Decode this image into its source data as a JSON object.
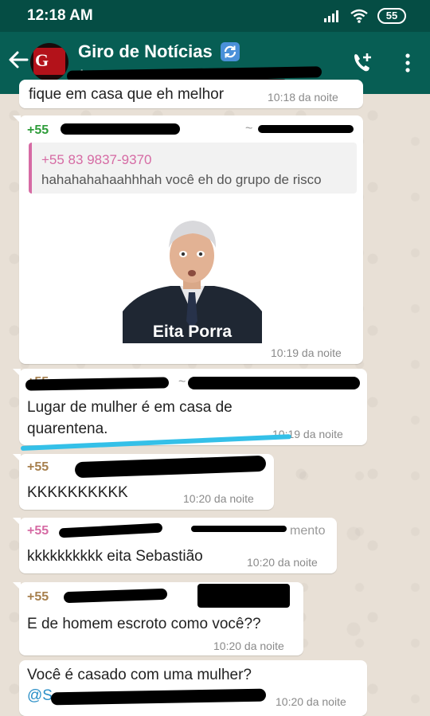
{
  "status_bar": {
    "time": "12:18 AM",
    "battery": "55"
  },
  "header": {
    "title": "Giro de Notícias",
    "subtitle": "A",
    "avatar_letter": "G"
  },
  "messages": [
    {
      "partial_text": "fique em casa que eh melhor",
      "time": "10:18 da noite"
    },
    {
      "sender": "+55",
      "sender_suffix": "~",
      "quote_sender": "+55 83 9837-9370",
      "quote_text": "hahahahahaahhhah você eh do grupo de risco",
      "sticker_caption": "Eita Porra",
      "time": "10:19 da noite"
    },
    {
      "sender": "+55",
      "sender_suffix": "~",
      "text_line1": "Lugar de mulher é em casa de",
      "text_line2": "quarentena.",
      "time": "10:19 da noite"
    },
    {
      "sender": "+55",
      "text": "KKKKKKKKKK",
      "time": "10:20 da noite"
    },
    {
      "sender": "+55",
      "sender_suffix": "mento",
      "text": "kkkkkkkkkk eita Sebastião",
      "time": "10:20 da noite"
    },
    {
      "sender": "+55",
      "text": "E de homem escroto como você??",
      "time": "10:20 da noite"
    },
    {
      "text": "Você é casado com uma mulher?",
      "mention": "@S",
      "time": "10:20 da noite"
    }
  ],
  "colors": {
    "header": "#075e54",
    "statusbar": "#054d44",
    "sender_green": "#2e9c3a",
    "sender_tan": "#a7804e",
    "sender_pink": "#d66ba4",
    "mention_blue": "#2a8fc7",
    "highlight_line": "#34c0e8"
  }
}
